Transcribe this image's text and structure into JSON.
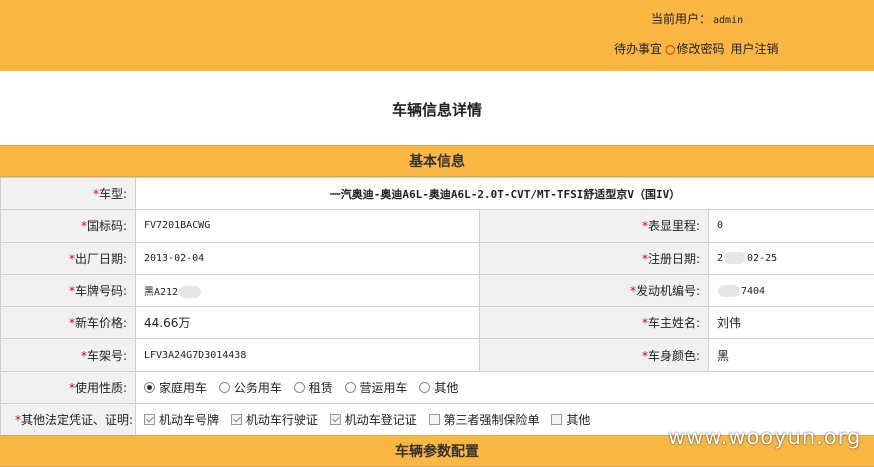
{
  "header": {
    "current_user_label": "当前用户：",
    "current_user_name": "admin",
    "todo": "待办事宜",
    "change_password": "修改密码",
    "logout": "用户注销"
  },
  "page_title": "车辆信息详情",
  "basic_section": {
    "title": "基本信息",
    "required_mark": "*",
    "model_label": "车型:",
    "model_value": "一汽奥迪-奥迪A6L-奥迪A6L-2.0T-CVT/MT-TFSI舒适型京V（国IV）",
    "national_code_label": "国标码:",
    "national_code_value": "FV7201BACWG",
    "mileage_label": "表显里程:",
    "mileage_value": "0",
    "factory_date_label": "出厂日期:",
    "factory_date_value": "2013-02-04",
    "reg_date_label": "注册日期:",
    "reg_date_prefix": "2",
    "reg_date_suffix": "02-25",
    "plate_label": "车牌号码:",
    "plate_value": "黑A212",
    "engine_no_label": "发动机编号:",
    "engine_no_suffix": "7404",
    "new_price_label": "新车价格:",
    "new_price_value": "44.66万",
    "owner_label": "车主姓名:",
    "owner_value": "刘伟",
    "vin_label": "车架号:",
    "vin_value": "LFV3A24G7D3014438",
    "body_color_label": "车身颜色:",
    "body_color_value": "黑",
    "usage_label": "使用性质:",
    "usage_options": [
      "家庭用车",
      "公务用车",
      "租赁",
      "营运用车",
      "其他"
    ],
    "usage_selected": "家庭用车",
    "docs_label": "其他法定凭证、证明:",
    "docs_options": [
      "机动车号牌",
      "机动车行驶证",
      "机动车登记证",
      "第三者强制保险单",
      "其他"
    ]
  },
  "params_section": {
    "title": "车辆参数配置"
  },
  "watermark": "www.wooyun.org",
  "colors": {
    "accent": "#fbb742",
    "label_bg": "#f1f1f1",
    "required": "#e00000"
  }
}
